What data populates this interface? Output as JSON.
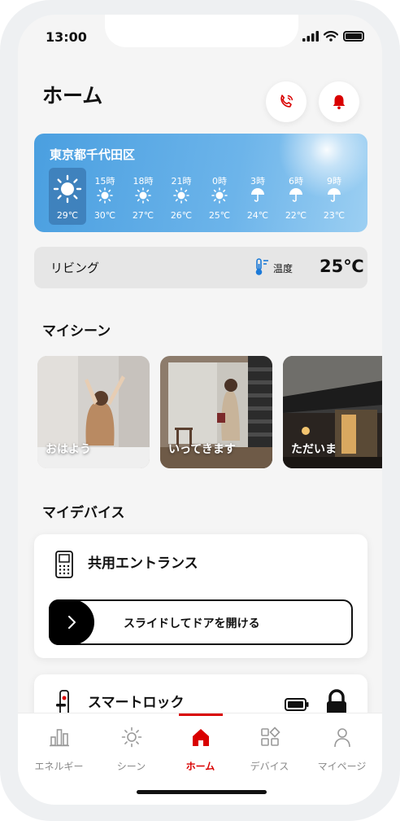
{
  "status": {
    "time": "13:00"
  },
  "header": {
    "title": "ホーム"
  },
  "weather": {
    "city": "東京都千代田区",
    "now": {
      "icon": "sun-icon",
      "temp": "29℃"
    },
    "hours": [
      {
        "label": "15時",
        "icon": "sun-icon",
        "temp": "30℃"
      },
      {
        "label": "18時",
        "icon": "sun-icon",
        "temp": "27℃"
      },
      {
        "label": "21時",
        "icon": "sun-icon",
        "temp": "26℃"
      },
      {
        "label": "0時",
        "icon": "sun-icon",
        "temp": "25℃"
      },
      {
        "label": "3時",
        "icon": "umbrella-icon",
        "temp": "24℃"
      },
      {
        "label": "6時",
        "icon": "umbrella-icon",
        "temp": "22℃"
      },
      {
        "label": "9時",
        "icon": "umbrella-icon",
        "temp": "23℃"
      }
    ]
  },
  "room": {
    "name": "リビング",
    "temp_label": "温度",
    "temp_value": "25℃"
  },
  "scenes": {
    "title": "マイシーン",
    "items": [
      {
        "label": "おはよう"
      },
      {
        "label": "いってきます"
      },
      {
        "label": "ただいま"
      }
    ]
  },
  "devices": {
    "title": "マイデバイス",
    "entrance": {
      "name": "共用エントランス",
      "slider_label": "スライドしてドアを開ける"
    },
    "lock": {
      "name": "スマートロック"
    }
  },
  "tabs": [
    {
      "label": "エネルギー",
      "icon": "bar-chart-icon"
    },
    {
      "label": "シーン",
      "icon": "sun-outline-icon"
    },
    {
      "label": "ホーム",
      "icon": "home-icon"
    },
    {
      "label": "デバイス",
      "icon": "apps-icon"
    },
    {
      "label": "マイページ",
      "icon": "person-icon"
    }
  ],
  "colors": {
    "accent": "#d90000",
    "weather_bg": "#5aaae6",
    "selected_hour": "#3f82bd"
  }
}
